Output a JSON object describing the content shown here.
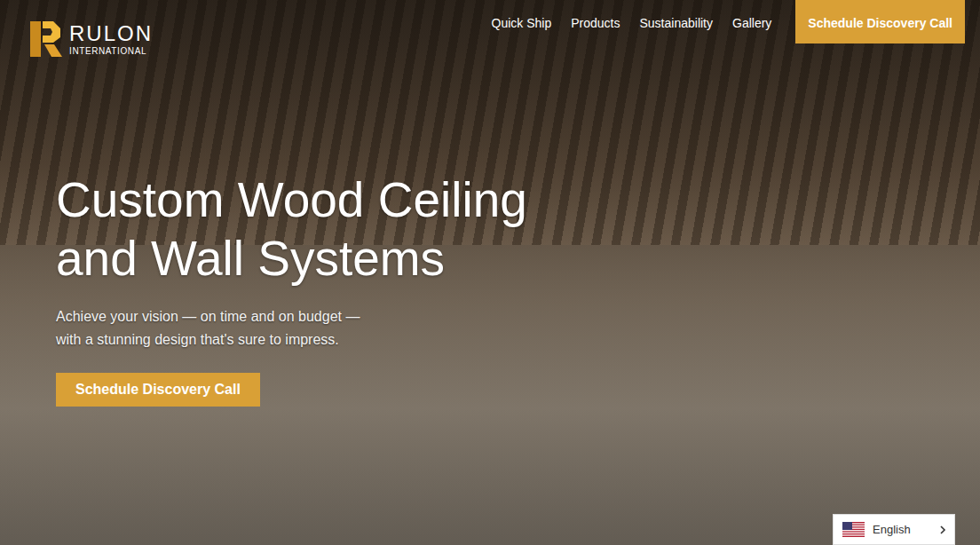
{
  "header": {
    "logo": {
      "name": "RULON",
      "tagline": "INTERNATIONAL"
    },
    "nav": [
      "Quick Ship",
      "Products",
      "Sustainability",
      "Gallery"
    ],
    "cta": "Schedule Discovery Call"
  },
  "hero": {
    "title_lines": [
      "Custom Wood Ceiling",
      "and Wall Systems"
    ],
    "subtitle_lines": [
      "Achieve your vision — on time and on budget —",
      "with a stunning design that's sure to impress."
    ],
    "button": "Schedule Discovery Call"
  },
  "language_selector": {
    "label": "English"
  }
}
